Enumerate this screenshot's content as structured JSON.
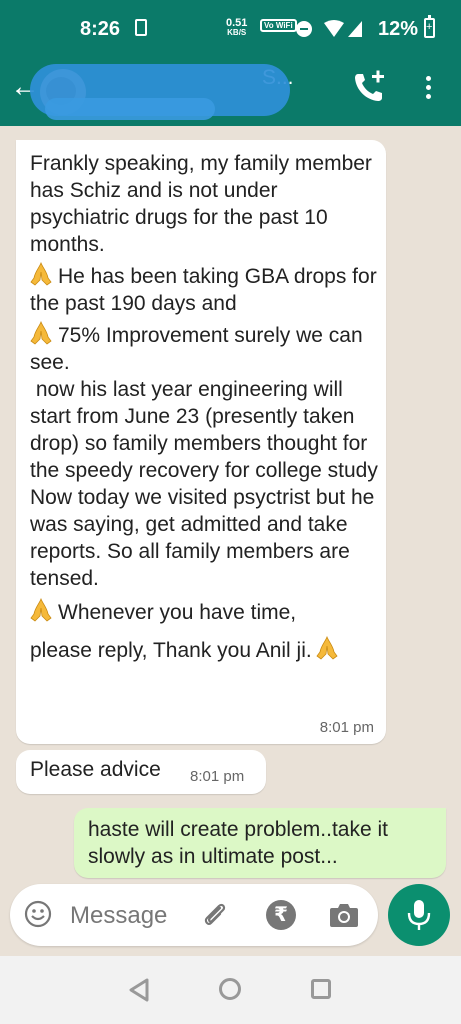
{
  "status_bar": {
    "time": "8:26",
    "speed_value": "0.51",
    "speed_unit": "KB/S",
    "wifi_label": "Vo WiFi",
    "battery": "12%"
  },
  "header": {
    "title": "S...",
    "subtitle": "",
    "accent_color": "#0b7a69"
  },
  "messages": [
    {
      "direction": "incoming",
      "paragraphs": [
        "Frankly speaking, my family member has Schiz and is not under psychiatric drugs for the past 10 months.",
        "He has been  taking GBA drops for the past 190 days and",
        "75% Improvement surely we can see.",
        " now his last year engineering will start from June 23 (presently taken drop) so family members thought for the speedy recovery for college study",
        "Now today we visited psyctrist but he was saying, get admitted and take reports. So all family members are tensed.",
        "Whenever you have time,",
        "please reply, Thank you Anil ji."
      ],
      "time": "8:01 pm"
    },
    {
      "direction": "incoming",
      "text": "Please advice",
      "time": "8:01 pm"
    },
    {
      "direction": "outgoing",
      "text": "haste will create problem..take it slowly as in ultimate post..."
    }
  ],
  "composer": {
    "placeholder": "Message",
    "rupee_symbol": "₹"
  },
  "icons": {
    "back": "arrow-left-icon",
    "add_call": "add-call-icon",
    "menu": "more-vert-icon",
    "emoji": "emoji-icon",
    "attach": "paperclip-icon",
    "camera": "camera-icon",
    "mic": "microphone-icon",
    "pray": "folded-hands-icon"
  }
}
